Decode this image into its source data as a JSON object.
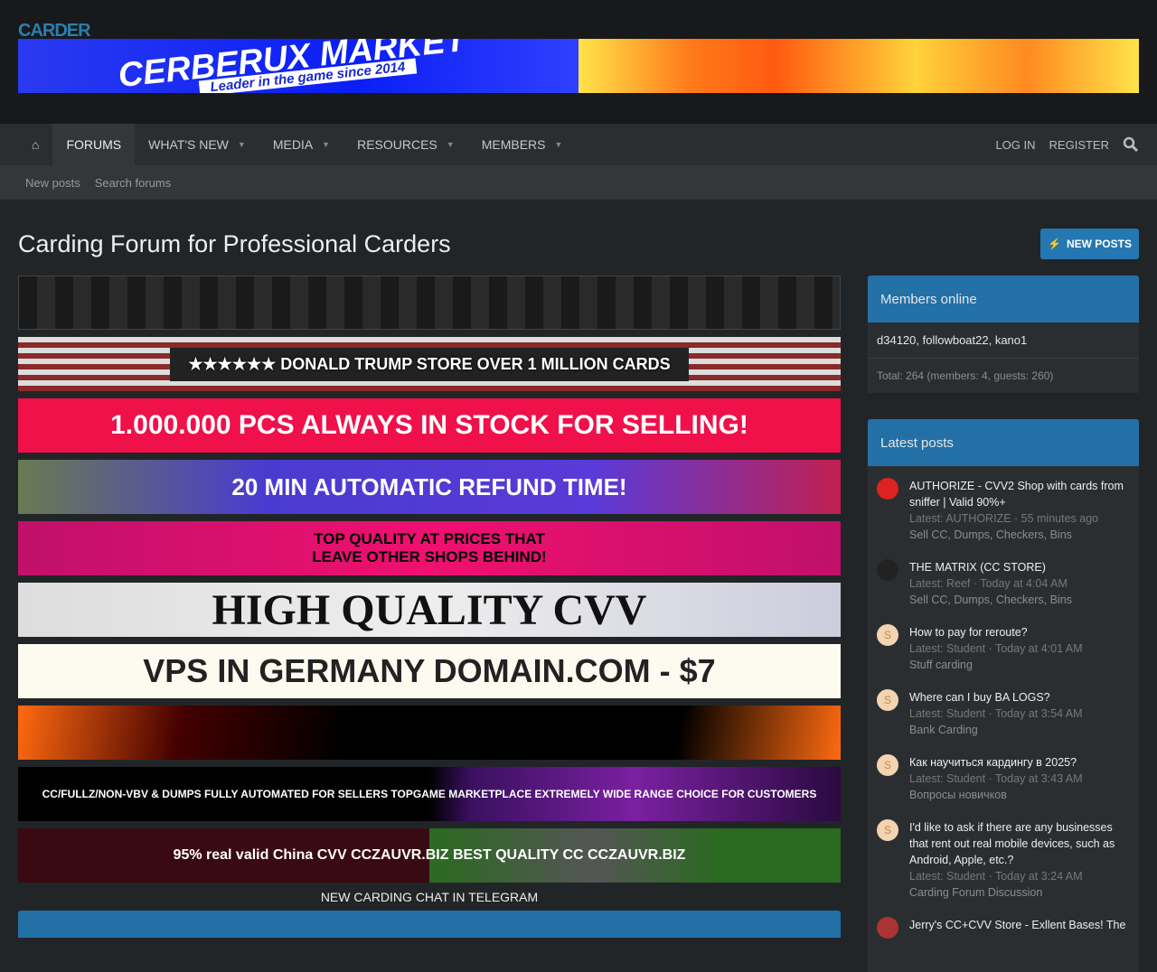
{
  "site": {
    "logo": "CARDER",
    "header_banner_title": "CERBERUX MARKET",
    "header_banner_sub": "Leader in the game since 2014"
  },
  "nav": {
    "items": [
      {
        "label": "FORUMS",
        "active": true
      },
      {
        "label": "WHAT'S NEW"
      },
      {
        "label": "MEDIA"
      },
      {
        "label": "RESOURCES"
      },
      {
        "label": "MEMBERS"
      }
    ],
    "login": "LOG IN",
    "register": "REGISTER"
  },
  "subnav": [
    "New posts",
    "Search forums"
  ],
  "page": {
    "title": "Carding Forum for Professional Carders",
    "new_posts": "NEW POSTS"
  },
  "banners": [
    {
      "text": ""
    },
    {
      "text": "★★★★★★  DONALD TRUMP STORE        OVER 1 MILLION CARDS"
    },
    {
      "text": "1.000.000  PCS ALWAYS IN STOCK FOR SELLING!"
    },
    {
      "text": "20 MIN AUTOMATIC REFUND TIME!"
    },
    {
      "text": "TOP QUALITY AT PRICES THAT LEAVE OTHER SHOPS BEHIND!"
    },
    {
      "text": "HIGH QUALITY CVV"
    },
    {
      "text": "VPS IN GERMANY  DOMAIN.COM - $7"
    },
    {
      "text": ""
    },
    {
      "text": "CC/FULLZ/NON-VBV & DUMPS   FULLY AUTOMATED FOR SELLERS   TOPGAME MARKETPLACE   EXTREMELY WIDE RANGE CHOICE FOR CUSTOMERS"
    },
    {
      "text": "95% real valid  China CVV   CCZAUVR.BIZ  BEST QUALITY CC  CCZAUVR.BIZ"
    }
  ],
  "chat_link": "NEW CARDING CHAT IN TELEGRAM",
  "members_online": {
    "title": "Members online",
    "names": "d34120, followboat22, kano1",
    "total": "Total: 264 (members: 4, guests: 260)"
  },
  "latest_posts": {
    "title": "Latest posts",
    "items": [
      {
        "avatar": "",
        "title": "AUTHORIZE - CVV2 Shop with cards from sniffer | Valid 90%+",
        "meta": "Latest: AUTHORIZE · 55 minutes ago",
        "forum": "Sell CC, Dumps, Checkers, Bins"
      },
      {
        "avatar": "",
        "title": "THE MATRIX (CC STORE)",
        "meta": "Latest: Reef · Today at 4:04 AM",
        "forum": "Sell CC, Dumps, Checkers, Bins"
      },
      {
        "avatar": "S",
        "title": "How to pay for reroute?",
        "meta": "Latest: Student · Today at 4:01 AM",
        "forum": "Stuff carding"
      },
      {
        "avatar": "S",
        "title": "Where can I buy BA LOGS?",
        "meta": "Latest: Student · Today at 3:54 AM",
        "forum": "Bank Carding"
      },
      {
        "avatar": "S",
        "title": "Как научиться кардингу в 2025?",
        "meta": "Latest: Student · Today at 3:43 AM",
        "forum": "Вопросы новичков"
      },
      {
        "avatar": "S",
        "title": "I'd like to ask if there are any businesses that rent out real mobile devices, such as Android, Apple, etc.?",
        "meta": "Latest: Student · Today at 3:24 AM",
        "forum": "Carding Forum Discussion"
      },
      {
        "avatar": "",
        "title": "Jerry's CC+CVV Store - Exllent Bases! The",
        "meta": "",
        "forum": ""
      }
    ]
  }
}
